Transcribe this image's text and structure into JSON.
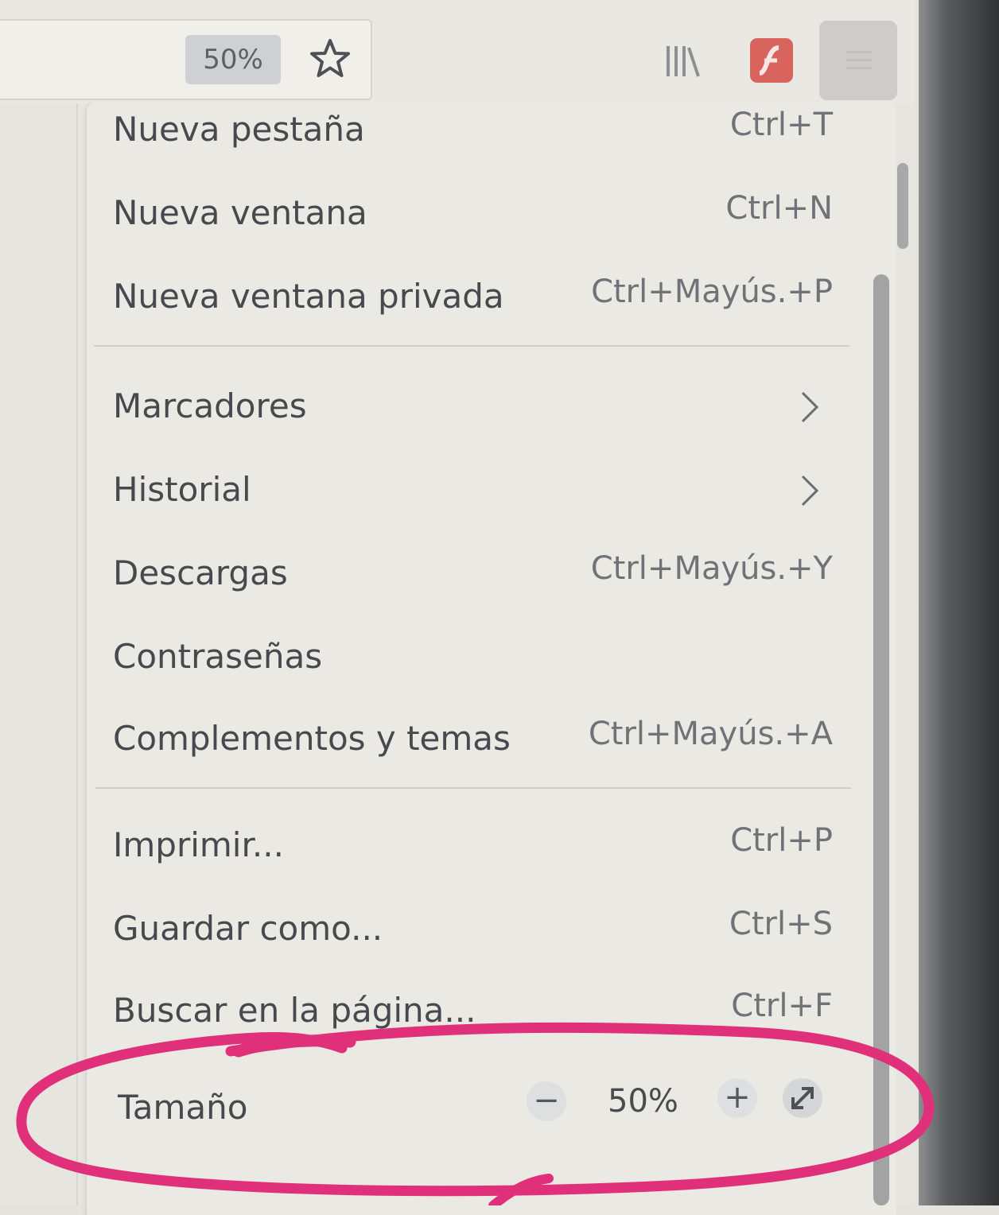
{
  "toolbar": {
    "zoom_badge": "50%",
    "icons": [
      "star-icon",
      "library-icon",
      "flash-icon",
      "menu-icon"
    ]
  },
  "menu": {
    "group1": [
      {
        "label": "Nueva pestaña",
        "shortcut": "Ctrl+T"
      },
      {
        "label": "Nueva ventana",
        "shortcut": "Ctrl+N"
      },
      {
        "label": "Nueva ventana privada",
        "shortcut": "Ctrl+Mayús.+P"
      }
    ],
    "group2": [
      {
        "label": "Marcadores",
        "shortcut": ""
      },
      {
        "label": "Historial",
        "shortcut": ""
      },
      {
        "label": "Descargas",
        "shortcut": "Ctrl+Mayús.+Y"
      },
      {
        "label": "Contraseñas",
        "shortcut": ""
      },
      {
        "label": "Complementos y temas",
        "shortcut": "Ctrl+Mayús.+A"
      }
    ],
    "group3": [
      {
        "label": "Imprimir...",
        "shortcut": "Ctrl+P"
      },
      {
        "label": "Guardar como...",
        "shortcut": "Ctrl+S"
      },
      {
        "label": "Buscar en la página...",
        "shortcut": "Ctrl+F"
      }
    ],
    "zoom": {
      "label": "Tamaño",
      "minus": "−",
      "value": "50%",
      "plus": "+",
      "fullscreen_icon": "fullscreen-icon"
    }
  },
  "colors": {
    "annotation": "#e0307a",
    "menu_bg": "#eae9e3",
    "text": "#48494e"
  }
}
